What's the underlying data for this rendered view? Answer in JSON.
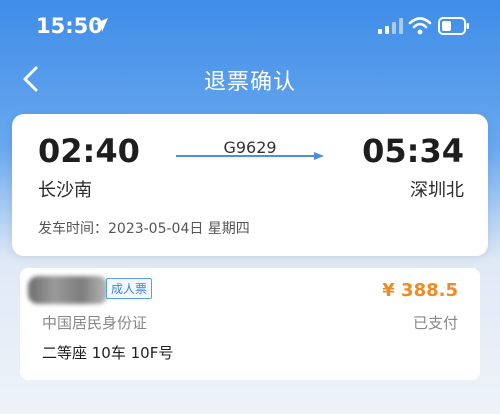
{
  "status_bar": {
    "time": "15:50",
    "icons": [
      "location-arrow-icon",
      "signal-icon",
      "wifi-icon",
      "battery-icon"
    ]
  },
  "nav": {
    "title": "退票确认",
    "back_icon": "back-chevron-icon"
  },
  "trip": {
    "departure_time": "02:40",
    "arrival_time": "05:34",
    "train_number": "G9629",
    "departure_station": "长沙南",
    "arrival_station": "深圳北",
    "depart_date_label": "发车时间：2023-05-04日 星期四"
  },
  "passenger": {
    "ticket_type": "成人票",
    "price": "¥ 388.5",
    "id_type": "中国居民身份证",
    "payment_status": "已支付",
    "seat": "二等座 10车 10F号"
  },
  "colors": {
    "header_blue": "#3f8de8",
    "price_orange": "#f08a24",
    "badge_blue": "#3b87d8"
  }
}
